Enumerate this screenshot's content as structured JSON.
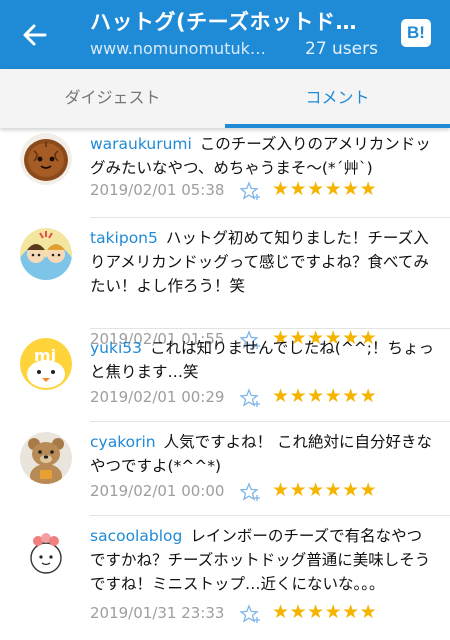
{
  "appbar": {
    "title": "ハットグ(チーズホットド…",
    "url": "www.nomunomutuk…",
    "users": "27 users",
    "hatena_label": "B!"
  },
  "tabs": [
    {
      "label": "ダイジェスト",
      "active": false
    },
    {
      "label": "コメント",
      "active": true
    }
  ],
  "colors": {
    "accent": "#1f8ad6",
    "star": "#f5b400",
    "username": "#1f8ad6"
  },
  "comments": [
    {
      "user": "waraukurumi",
      "text": "このチーズ入りのアメリカンドッグみたいなやつ、めちゃうまそ〜(*´艸`)",
      "date": "2019/02/01 05:38",
      "stars": "★★★★★★"
    },
    {
      "user": "takipon5",
      "text": "ハットグ初めて知りました！チーズ入りアメリカンドッグって感じですよね？食べてみたい！よし作ろう！笑",
      "date": "2019/02/01 01:55",
      "stars": "★★★★★★"
    },
    {
      "user": "yuki53",
      "text": "これは知りませんでしたね(^^;！ちょっと焦ります…笑",
      "date": "2019/02/01 00:29",
      "stars": "★★★★★★"
    },
    {
      "user": "cyakorin",
      "text": "人気ですよね！ これ絶対に自分好きなやつですよ(*^^*)",
      "date": "2019/02/01 00:00",
      "stars": "★★★★★★"
    },
    {
      "user": "sacoolablog",
      "text": "レインボーのチーズで有名なやつですかね？チーズホットドッグ普通に美味しそうですね！ミニストップ…近くにないな。。。",
      "date": "2019/01/31 23:33",
      "stars": "★★★★★★"
    }
  ]
}
